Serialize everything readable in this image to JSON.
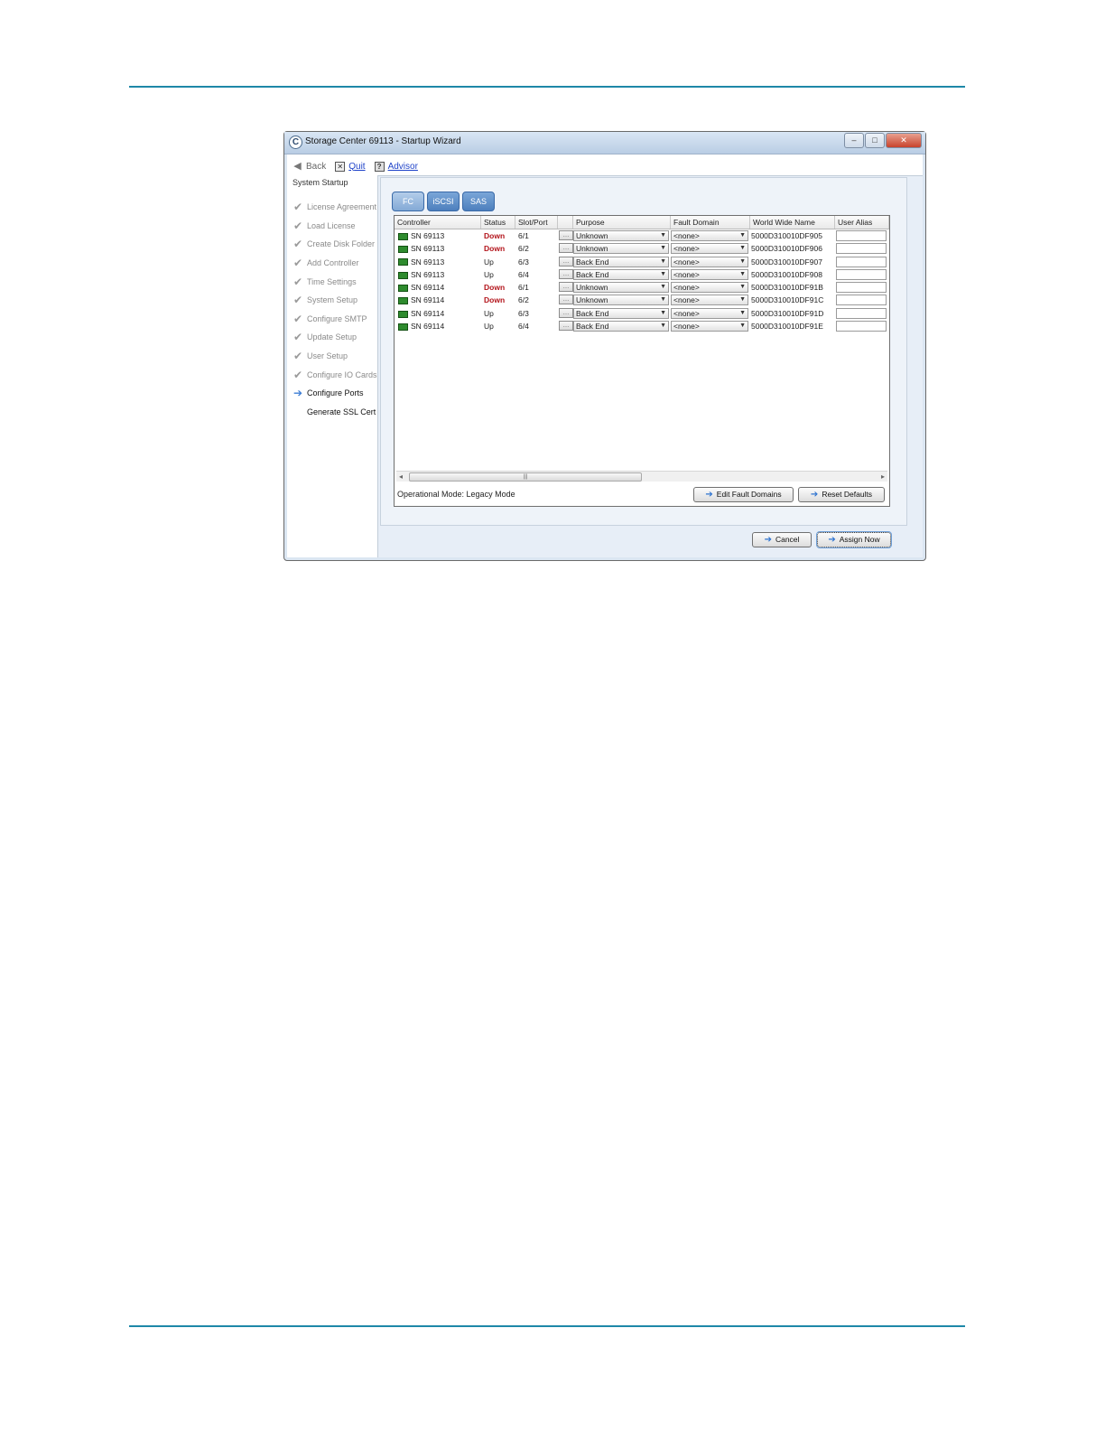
{
  "window": {
    "title": "Storage Center 69113 - Startup Wizard",
    "app_icon": "C",
    "minimize_glyph": "–",
    "maximize_glyph": "□",
    "close_glyph": "✕"
  },
  "toolbar": {
    "back_label": "Back",
    "back_icon": "◀",
    "quit_label": "Quit",
    "quit_icon": "✕",
    "advisor_label": "Advisor",
    "advisor_icon": "?"
  },
  "sidebar": {
    "title": "System Startup",
    "done_mark": "✔",
    "current_mark": "➔",
    "steps": [
      {
        "label": "License Agreement",
        "state": "done"
      },
      {
        "label": "Load License",
        "state": "done"
      },
      {
        "label": "Create Disk Folder",
        "state": "done"
      },
      {
        "label": "Add Controller",
        "state": "done"
      },
      {
        "label": "Time Settings",
        "state": "done"
      },
      {
        "label": "System Setup",
        "state": "done"
      },
      {
        "label": "Configure SMTP",
        "state": "done"
      },
      {
        "label": "Update Setup",
        "state": "done"
      },
      {
        "label": "User Setup",
        "state": "done"
      },
      {
        "label": "Configure IO Cards",
        "state": "done"
      },
      {
        "label": "Configure Ports",
        "state": "current"
      },
      {
        "label": "Generate SSL Cert",
        "state": "pending"
      }
    ]
  },
  "tabs": [
    {
      "label": "FC",
      "active": true
    },
    {
      "label": "iSCSI",
      "active": false
    },
    {
      "label": "SAS",
      "active": false
    }
  ],
  "table": {
    "columns": [
      "Controller",
      "Status",
      "Slot/Port",
      "",
      "Purpose",
      "Fault Domain",
      "World Wide Name",
      "User Alias"
    ],
    "rows": [
      {
        "controller": "SN 69113",
        "status": "Down",
        "slot": "6/1",
        "purpose": "Unknown",
        "fault_domain": "<none>",
        "wwn": "5000D310010DF905",
        "alias": ""
      },
      {
        "controller": "SN 69113",
        "status": "Down",
        "slot": "6/2",
        "purpose": "Unknown",
        "fault_domain": "<none>",
        "wwn": "5000D310010DF906",
        "alias": ""
      },
      {
        "controller": "SN 69113",
        "status": "Up",
        "slot": "6/3",
        "purpose": "Back End",
        "fault_domain": "<none>",
        "wwn": "5000D310010DF907",
        "alias": ""
      },
      {
        "controller": "SN 69113",
        "status": "Up",
        "slot": "6/4",
        "purpose": "Back End",
        "fault_domain": "<none>",
        "wwn": "5000D310010DF908",
        "alias": ""
      },
      {
        "controller": "SN 69114",
        "status": "Down",
        "slot": "6/1",
        "purpose": "Unknown",
        "fault_domain": "<none>",
        "wwn": "5000D310010DF91B",
        "alias": ""
      },
      {
        "controller": "SN 69114",
        "status": "Down",
        "slot": "6/2",
        "purpose": "Unknown",
        "fault_domain": "<none>",
        "wwn": "5000D310010DF91C",
        "alias": ""
      },
      {
        "controller": "SN 69114",
        "status": "Up",
        "slot": "6/3",
        "purpose": "Back End",
        "fault_domain": "<none>",
        "wwn": "5000D310010DF91D",
        "alias": ""
      },
      {
        "controller": "SN 69114",
        "status": "Up",
        "slot": "6/4",
        "purpose": "Back End",
        "fault_domain": "<none>",
        "wwn": "5000D310010DF91E",
        "alias": ""
      }
    ],
    "status_colors": {
      "Down": "#b3141b",
      "Up": "#222222"
    },
    "scroll_left_glyph": "◂",
    "scroll_right_glyph": "▸",
    "scroll_grip": "|||"
  },
  "operational_mode": "Operational Mode: Legacy Mode",
  "buttons": {
    "edit_fault_domains": "Edit Fault Domains",
    "reset_defaults": "Reset Defaults",
    "cancel": "Cancel",
    "assign_now": "Assign Now",
    "arrow_icon": "➔"
  },
  "colors": {
    "accent_rule": "#1e88a8",
    "tab_blue": "#4d7fbd",
    "controller_icon": "#2e8b2e"
  }
}
